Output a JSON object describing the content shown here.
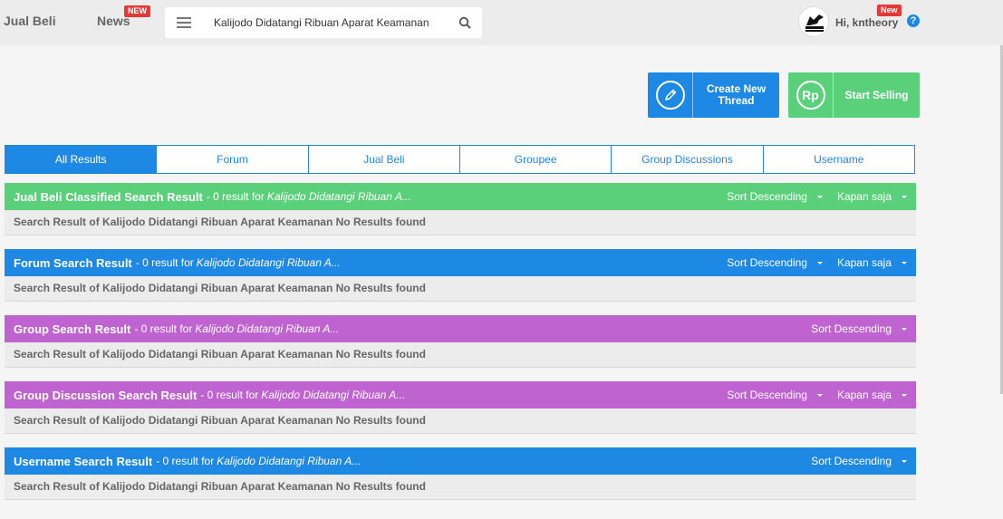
{
  "topbar": {
    "jual_beli": "Jual Beli",
    "news": "News",
    "news_badge": "NEW",
    "search_value": "Kalijodo Didatangi Ribuan Aparat Keamanan",
    "greeting": "Hi, kntheory",
    "user_badge": "New",
    "help": "?"
  },
  "actions": {
    "create_label": "Create New Thread",
    "sell_icon": "Rp",
    "sell_label": "Start Selling"
  },
  "tabs": [
    "All Results",
    "Forum",
    "Jual Beli",
    "Groupee",
    "Group Discussions",
    "Username"
  ],
  "sections": [
    {
      "title": "Jual Beli Classified Search Result",
      "info": "- 0 result for",
      "query": "Kalijodo Didatangi Ribuan A...",
      "sort": "Sort Descending",
      "time": "Kapan saja",
      "body": "Search Result of Kalijodo Didatangi Ribuan Aparat Keamanan No Results found"
    },
    {
      "title": "Forum Search Result",
      "info": "- 0 result for",
      "query": "Kalijodo Didatangi Ribuan A...",
      "sort": "Sort Descending",
      "time": "Kapan saja",
      "body": "Search Result of Kalijodo Didatangi Ribuan Aparat Keamanan No Results found"
    },
    {
      "title": "Group Search Result",
      "info": "- 0 result for",
      "query": "Kalijodo Didatangi Ribuan A...",
      "sort": "Sort Descending",
      "body": "Search Result of Kalijodo Didatangi Ribuan Aparat Keamanan No Results found"
    },
    {
      "title": "Group Discussion Search Result",
      "info": "- 0 result for",
      "query": "Kalijodo Didatangi Ribuan A...",
      "sort": "Sort Descending",
      "time": "Kapan saja",
      "body": "Search Result of Kalijodo Didatangi Ribuan Aparat Keamanan No Results found"
    },
    {
      "title": "Username Search Result",
      "info": "- 0 result for",
      "query": "Kalijodo Didatangi Ribuan A...",
      "sort": "Sort Descending",
      "body": "Search Result of Kalijodo Didatangi Ribuan Aparat Keamanan No Results found"
    }
  ],
  "colors": {
    "blue": "#1e88e5",
    "green": "#5bd07a",
    "purple": "#be63cf",
    "badge_red": "#e53935"
  }
}
